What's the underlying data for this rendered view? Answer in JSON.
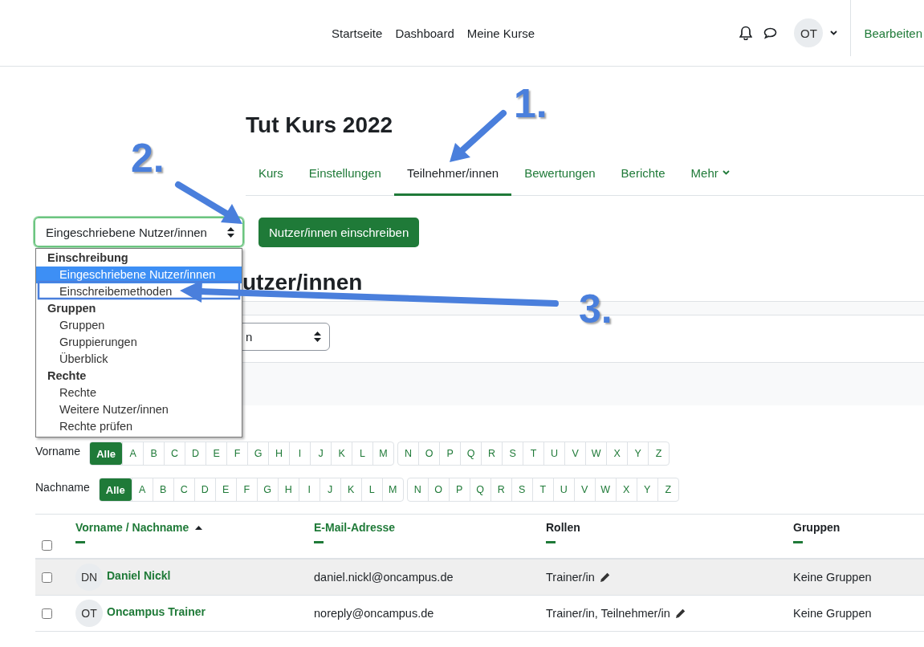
{
  "header": {
    "nav": [
      "Startseite",
      "Dashboard",
      "Meine Kurse"
    ],
    "avatar": "OT",
    "edit_link": "Bearbeiten"
  },
  "course": {
    "title": "Tut Kurs 2022",
    "tabs": [
      {
        "label": "Kurs",
        "selected": false,
        "kind": "link"
      },
      {
        "label": "Einstellungen",
        "selected": false,
        "kind": "link"
      },
      {
        "label": "Teilnehmer/innen",
        "selected": true,
        "kind": "link"
      },
      {
        "label": "Bewertungen",
        "selected": false,
        "kind": "link"
      },
      {
        "label": "Berichte",
        "selected": false,
        "kind": "link"
      },
      {
        "label": "Mehr",
        "selected": false,
        "kind": "menu"
      }
    ]
  },
  "page_select": {
    "value": "Eingeschriebene Nutzer/innen",
    "open": true
  },
  "enrol_button": "Nutzer/innen einschreiben",
  "dropdown": {
    "groups": [
      {
        "label": "Einschreibung",
        "options": [
          {
            "label": "Eingeschriebene Nutzer/innen",
            "selected": true
          },
          {
            "label": "Einschreibemethoden",
            "selected": false
          }
        ]
      },
      {
        "label": "Gruppen",
        "options": [
          {
            "label": "Gruppen",
            "selected": false
          },
          {
            "label": "Gruppierungen",
            "selected": false
          },
          {
            "label": "Überblick",
            "selected": false
          }
        ]
      },
      {
        "label": "Rechte",
        "options": [
          {
            "label": "Rechte",
            "selected": false
          },
          {
            "label": "Weitere Nutzer/innen",
            "selected": false
          },
          {
            "label": "Rechte prüfen",
            "selected": false
          }
        ]
      }
    ]
  },
  "heading": "utzer/innen",
  "filter_select": {
    "value": "n"
  },
  "letter_filters": [
    {
      "label": "Vorname",
      "groups": [
        [
          {
            "label": "Alle",
            "selected": true
          },
          {
            "label": "A",
            "selected": false
          },
          {
            "label": "B",
            "selected": false
          },
          {
            "label": "C",
            "selected": false
          },
          {
            "label": "D",
            "selected": false
          },
          {
            "label": "E",
            "selected": false
          },
          {
            "label": "F",
            "selected": false
          },
          {
            "label": "G",
            "selected": false
          },
          {
            "label": "H",
            "selected": false
          },
          {
            "label": "I",
            "selected": false
          },
          {
            "label": "J",
            "selected": false
          },
          {
            "label": "K",
            "selected": false
          },
          {
            "label": "L",
            "selected": false
          },
          {
            "label": "M",
            "selected": false
          }
        ],
        [
          {
            "label": "N",
            "selected": false
          },
          {
            "label": "O",
            "selected": false
          },
          {
            "label": "P",
            "selected": false
          },
          {
            "label": "Q",
            "selected": false
          },
          {
            "label": "R",
            "selected": false
          },
          {
            "label": "S",
            "selected": false
          },
          {
            "label": "T",
            "selected": false
          },
          {
            "label": "U",
            "selected": false
          },
          {
            "label": "V",
            "selected": false
          },
          {
            "label": "W",
            "selected": false
          },
          {
            "label": "X",
            "selected": false
          },
          {
            "label": "Y",
            "selected": false
          },
          {
            "label": "Z",
            "selected": false
          }
        ]
      ]
    },
    {
      "label": "Nachname",
      "groups": [
        [
          {
            "label": "Alle",
            "selected": true
          },
          {
            "label": "A",
            "selected": false
          },
          {
            "label": "B",
            "selected": false
          },
          {
            "label": "C",
            "selected": false
          },
          {
            "label": "D",
            "selected": false
          },
          {
            "label": "E",
            "selected": false
          },
          {
            "label": "F",
            "selected": false
          },
          {
            "label": "G",
            "selected": false
          },
          {
            "label": "H",
            "selected": false
          },
          {
            "label": "I",
            "selected": false
          },
          {
            "label": "J",
            "selected": false
          },
          {
            "label": "K",
            "selected": false
          },
          {
            "label": "L",
            "selected": false
          },
          {
            "label": "M",
            "selected": false
          }
        ],
        [
          {
            "label": "N",
            "selected": false
          },
          {
            "label": "O",
            "selected": false
          },
          {
            "label": "P",
            "selected": false
          },
          {
            "label": "Q",
            "selected": false
          },
          {
            "label": "R",
            "selected": false
          },
          {
            "label": "S",
            "selected": false
          },
          {
            "label": "T",
            "selected": false
          },
          {
            "label": "U",
            "selected": false
          },
          {
            "label": "V",
            "selected": false
          },
          {
            "label": "W",
            "selected": false
          },
          {
            "label": "X",
            "selected": false
          },
          {
            "label": "Y",
            "selected": false
          },
          {
            "label": "Z",
            "selected": false
          }
        ]
      ]
    }
  ],
  "table": {
    "select_all": false,
    "columns": [
      {
        "label": "Vorname / Nachname",
        "kind": "link",
        "sorted": true
      },
      {
        "label": "E-Mail-Adresse",
        "kind": "link"
      },
      {
        "label": "Rollen",
        "kind": "plain"
      },
      {
        "label": "Gruppen",
        "kind": "plain"
      }
    ],
    "rows": [
      {
        "selected": false,
        "hovered": true,
        "avatar": "DN",
        "name": "Daniel Nickl",
        "email": "daniel.nickl@oncampus.de",
        "roles": "Trainer/in",
        "groups": "Keine Gruppen"
      },
      {
        "selected": false,
        "hovered": false,
        "avatar": "OT",
        "name": "Oncampus Trainer",
        "email": "noreply@oncampus.de",
        "roles": "Trainer/in, Teilnehmer/in",
        "groups": "Keine Gruppen"
      }
    ]
  },
  "annotations": [
    {
      "label": "1."
    },
    {
      "label": "2."
    },
    {
      "label": "3."
    }
  ]
}
